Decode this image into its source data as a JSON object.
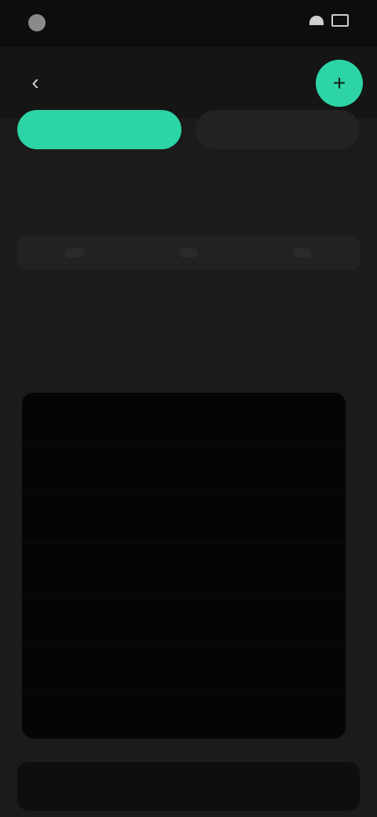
{
  "statusBar": {
    "time": "",
    "icons": {
      "signal": "signal-icon",
      "wifi": "wifi-icon",
      "battery": "battery-icon"
    }
  },
  "header": {
    "title": "",
    "back_icon": "chevron-left-icon",
    "fab_icon": "plus-icon"
  },
  "tabs": [
    {
      "label": ""
    },
    {
      "label": ""
    }
  ],
  "info": {
    "pills": [
      "",
      "",
      ""
    ]
  },
  "section": {
    "label": ""
  },
  "list": {
    "items": [
      {
        "label": ""
      },
      {
        "label": ""
      },
      {
        "label": ""
      },
      {
        "label": ""
      },
      {
        "label": ""
      },
      {
        "label": ""
      },
      {
        "label": ""
      }
    ]
  },
  "bottom": {
    "left": "",
    "right": ""
  },
  "colors": {
    "accent": "#2dd4a5",
    "background": "#1b1b1b",
    "panel": "#050505"
  }
}
